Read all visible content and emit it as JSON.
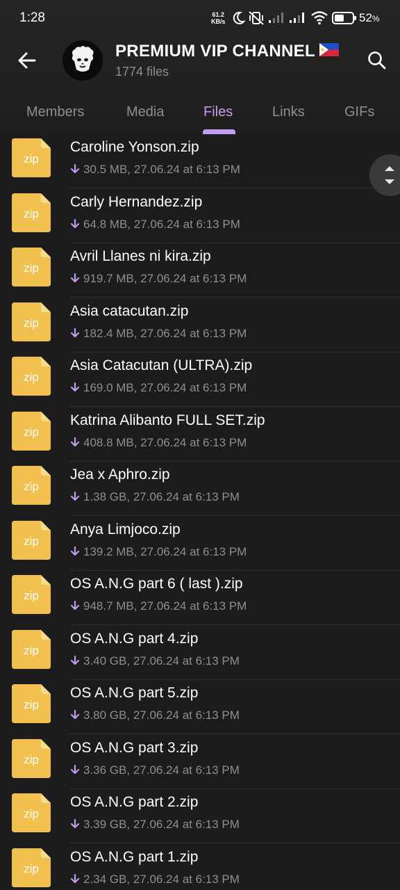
{
  "status_bar": {
    "time": "1:28",
    "net_speed_value": "61.2",
    "net_speed_unit": "KB/s",
    "battery_percent": "52"
  },
  "header": {
    "title": "PREMIUM VIP CHANNEL",
    "subtitle": "1774 files"
  },
  "tabs": [
    {
      "label": "Members",
      "active": false
    },
    {
      "label": "Media",
      "active": false
    },
    {
      "label": "Files",
      "active": true
    },
    {
      "label": "Links",
      "active": false
    },
    {
      "label": "GIFs",
      "active": false
    }
  ],
  "file_icon_label": "zip",
  "files": [
    {
      "name": "Caroline Yonson.zip",
      "meta": "30.5 MB, 27.06.24 at 6:13 PM"
    },
    {
      "name": "Carly Hernandez.zip",
      "meta": "64.8 MB, 27.06.24 at 6:13 PM"
    },
    {
      "name": "Avril Llanes ni kira.zip",
      "meta": "919.7 MB, 27.06.24 at 6:13 PM"
    },
    {
      "name": "Asia catacutan.zip",
      "meta": "182.4 MB, 27.06.24 at 6:13 PM"
    },
    {
      "name": "Asia Catacutan (ULTRA).zip",
      "meta": "169.0 MB, 27.06.24 at 6:13 PM"
    },
    {
      "name": "Katrina Alibanto FULL SET.zip",
      "meta": "408.8 MB, 27.06.24 at 6:13 PM"
    },
    {
      "name": "Jea x Aphro.zip",
      "meta": "1.38 GB, 27.06.24 at 6:13 PM"
    },
    {
      "name": "Anya Limjoco.zip",
      "meta": "139.2 MB, 27.06.24 at 6:13 PM"
    },
    {
      "name": "OS A.N.G part 6 ( last ).zip",
      "meta": "948.7 MB, 27.06.24 at 6:13 PM"
    },
    {
      "name": "OS A.N.G part 4.zip",
      "meta": "3.40 GB, 27.06.24 at 6:13 PM"
    },
    {
      "name": "OS A.N.G part 5.zip",
      "meta": "3.80 GB, 27.06.24 at 6:13 PM"
    },
    {
      "name": "OS A.N.G part 3.zip",
      "meta": "3.36 GB, 27.06.24 at 6:13 PM"
    },
    {
      "name": "OS A.N.G part 2.zip",
      "meta": "3.39 GB, 27.06.24 at 6:13 PM"
    },
    {
      "name": "OS A.N.G part 1.zip",
      "meta": "2.34 GB, 27.06.24 at 6:13 PM"
    }
  ],
  "colors": {
    "background": "#1c1c1d",
    "accent": "#c29cf2",
    "secondary_text": "#8e8e93",
    "file_icon": "#f2c04e"
  },
  "icons": {
    "back": "arrow-left-icon",
    "search": "search-icon",
    "download": "arrow-down-icon",
    "file": "zip-file-icon",
    "flag": "philippines-flag-icon",
    "scroll": "scroll-handle-icon"
  }
}
